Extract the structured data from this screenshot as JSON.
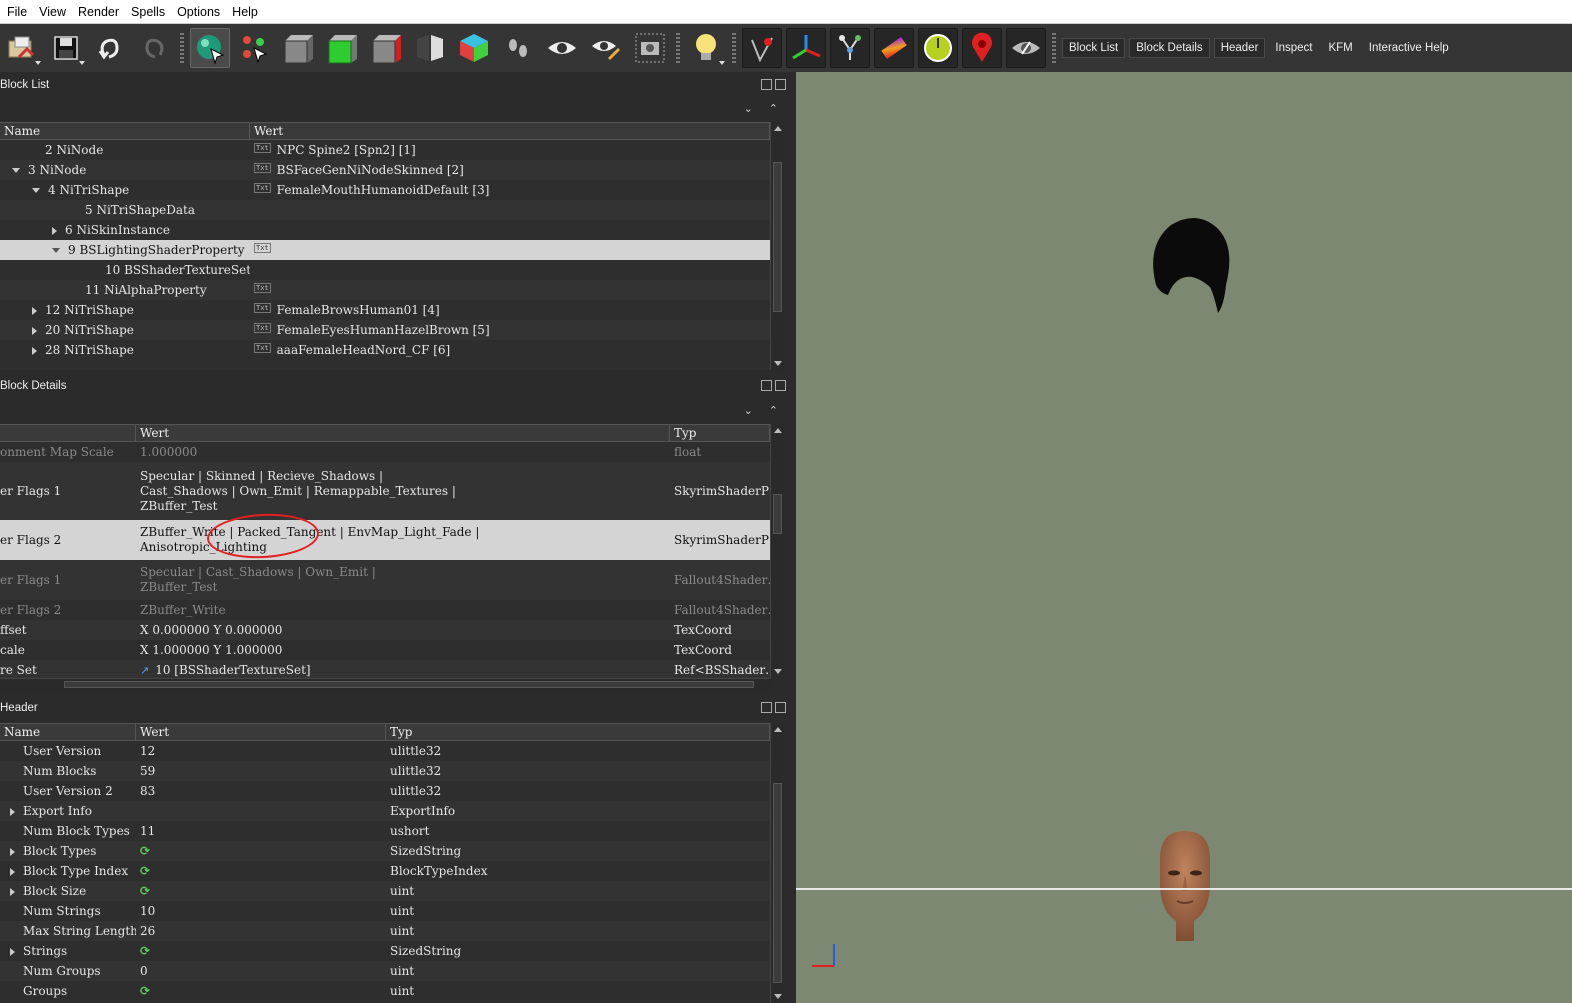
{
  "menu": [
    "File",
    "View",
    "Render",
    "Spells",
    "Options",
    "Help"
  ],
  "toolbar": {
    "icons": [
      "load-icon",
      "save-icon",
      "undo-icon",
      "redo-icon",
      "select-sphere-icon",
      "node-select-icon",
      "box-gray-icon",
      "box-green-icon",
      "box-red-icon",
      "split-view-icon",
      "cube-color-icon",
      "footprints-icon",
      "eye-icon",
      "eye-pencil-icon",
      "camera-icon",
      "light-bulb-icon",
      "vertex-pin-icon",
      "axes-icon",
      "skeleton-icon",
      "gradient-icon",
      "clock-icon",
      "map-pin-icon",
      "hide-eye-icon"
    ],
    "tabs": [
      "Block List",
      "Block Details",
      "Header",
      "Inspect",
      "KFM",
      "Interactive Help"
    ]
  },
  "block_list": {
    "title": "Block List",
    "columns": [
      "Name",
      "Wert"
    ],
    "rows": [
      {
        "name": "2 NiNode",
        "value": "NPC Spine2 [Spn2] [1]",
        "indent": 2,
        "toggle": "none",
        "txt": true
      },
      {
        "name": "3 NiNode",
        "value": "BSFaceGenNiNodeSkinned [2]",
        "indent": 1,
        "toggle": "open",
        "txt": true
      },
      {
        "name": "4 NiTriShape",
        "value": "FemaleMouthHumanoidDefault [3]",
        "indent": 2,
        "toggle": "open",
        "txt": true
      },
      {
        "name": "5 NiTriShapeData",
        "value": "",
        "indent": 4,
        "toggle": "none",
        "txt": false
      },
      {
        "name": "6 NiSkinInstance",
        "value": "",
        "indent": 3,
        "toggle": "closed",
        "txt": false
      },
      {
        "name": "9 BSLightingShaderProperty",
        "value": "",
        "indent": 3,
        "toggle": "open",
        "txt": true,
        "selected": true
      },
      {
        "name": "10 BSShaderTextureSet",
        "value": "",
        "indent": 5,
        "toggle": "none",
        "txt": false
      },
      {
        "name": "11 NiAlphaProperty",
        "value": "",
        "indent": 4,
        "toggle": "none",
        "txt": true
      },
      {
        "name": "12 NiTriShape",
        "value": "FemaleBrowsHuman01 [4]",
        "indent": 2,
        "toggle": "closed",
        "txt": true
      },
      {
        "name": "20 NiTriShape",
        "value": "FemaleEyesHumanHazelBrown [5]",
        "indent": 2,
        "toggle": "closed",
        "txt": true
      },
      {
        "name": "28 NiTriShape",
        "value": "aaaFemaleHeadNord_CF [6]",
        "indent": 2,
        "toggle": "closed",
        "txt": true
      }
    ]
  },
  "block_details": {
    "title": "Block Details",
    "columns": [
      "",
      "Wert",
      "Typ"
    ],
    "rows": [
      {
        "name": "onment Map Scale",
        "value": [
          "1.000000"
        ],
        "type": "float",
        "dim": true
      },
      {
        "name": "er Flags 1",
        "value": [
          "Specular | Skinned | Recieve_Shadows |",
          "Cast_Shadows | Own_Emit | Remappable_Textures |",
          "ZBuffer_Test"
        ],
        "type": "SkyrimShaderP…"
      },
      {
        "name": "er Flags 2",
        "value": [
          "ZBuffer_Write | Packed_Tangent | EnvMap_Light_Fade |",
          "Anisotropic_Lighting"
        ],
        "type": "SkyrimShaderP…",
        "selected": true
      },
      {
        "name": "er Flags 1",
        "value": [
          "Specular | Cast_Shadows | Own_Emit |",
          "ZBuffer_Test"
        ],
        "type": "Fallout4Shader…",
        "dim": true
      },
      {
        "name": "er Flags 2",
        "value": [
          "ZBuffer_Write"
        ],
        "type": "Fallout4Shader…",
        "dim": true
      },
      {
        "name": "ffset",
        "value": [
          "X 0.000000 Y 0.000000"
        ],
        "type": "TexCoord"
      },
      {
        "name": "cale",
        "value": [
          "X 1.000000 Y 1.000000"
        ],
        "type": "TexCoord"
      },
      {
        "name": "re Set",
        "value": [
          "10 [BSShaderTextureSet]"
        ],
        "type": "Ref<BSShader…",
        "ref": true
      }
    ]
  },
  "header": {
    "title": "Header",
    "columns": [
      "Name",
      "Wert",
      "Typ"
    ],
    "rows": [
      {
        "name": "User Version",
        "value": "12",
        "type": "ulittle32",
        "toggle": false
      },
      {
        "name": "Num Blocks",
        "value": "59",
        "type": "ulittle32",
        "toggle": false
      },
      {
        "name": "User Version 2",
        "value": "83",
        "type": "ulittle32",
        "toggle": false
      },
      {
        "name": "Export Info",
        "value": "",
        "type": "ExportInfo",
        "toggle": true
      },
      {
        "name": "Num Block Types",
        "value": "11",
        "type": "ushort",
        "toggle": false
      },
      {
        "name": "Block Types",
        "value": "",
        "type": "SizedString",
        "toggle": true,
        "link": true
      },
      {
        "name": "Block Type Index",
        "value": "",
        "type": "BlockTypeIndex",
        "toggle": true,
        "link": true
      },
      {
        "name": "Block Size",
        "value": "",
        "type": "uint",
        "toggle": true,
        "link": true
      },
      {
        "name": "Num Strings",
        "value": "10",
        "type": "uint",
        "toggle": false
      },
      {
        "name": "Max String Length",
        "value": "26",
        "type": "uint",
        "toggle": false
      },
      {
        "name": "Strings",
        "value": "",
        "type": "SizedString",
        "toggle": true,
        "link": true
      },
      {
        "name": "Num Groups",
        "value": "0",
        "type": "uint",
        "toggle": false
      },
      {
        "name": "Groups",
        "value": "",
        "type": "uint",
        "toggle": false,
        "link": true
      }
    ]
  },
  "viewport": {
    "background": "#7d8873",
    "annotation_color": "#e12020"
  }
}
